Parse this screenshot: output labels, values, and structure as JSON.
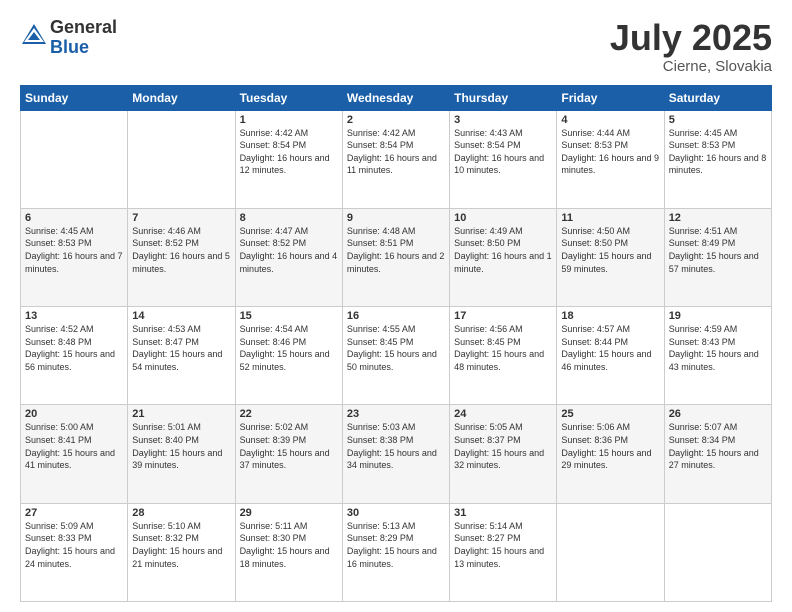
{
  "header": {
    "logo_general": "General",
    "logo_blue": "Blue",
    "month": "July 2025",
    "location": "Cierne, Slovakia"
  },
  "days_of_week": [
    "Sunday",
    "Monday",
    "Tuesday",
    "Wednesday",
    "Thursday",
    "Friday",
    "Saturday"
  ],
  "weeks": [
    [
      {
        "day": "",
        "info": ""
      },
      {
        "day": "",
        "info": ""
      },
      {
        "day": "1",
        "info": "Sunrise: 4:42 AM\nSunset: 8:54 PM\nDaylight: 16 hours and 12 minutes."
      },
      {
        "day": "2",
        "info": "Sunrise: 4:42 AM\nSunset: 8:54 PM\nDaylight: 16 hours and 11 minutes."
      },
      {
        "day": "3",
        "info": "Sunrise: 4:43 AM\nSunset: 8:54 PM\nDaylight: 16 hours and 10 minutes."
      },
      {
        "day": "4",
        "info": "Sunrise: 4:44 AM\nSunset: 8:53 PM\nDaylight: 16 hours and 9 minutes."
      },
      {
        "day": "5",
        "info": "Sunrise: 4:45 AM\nSunset: 8:53 PM\nDaylight: 16 hours and 8 minutes."
      }
    ],
    [
      {
        "day": "6",
        "info": "Sunrise: 4:45 AM\nSunset: 8:53 PM\nDaylight: 16 hours and 7 minutes."
      },
      {
        "day": "7",
        "info": "Sunrise: 4:46 AM\nSunset: 8:52 PM\nDaylight: 16 hours and 5 minutes."
      },
      {
        "day": "8",
        "info": "Sunrise: 4:47 AM\nSunset: 8:52 PM\nDaylight: 16 hours and 4 minutes."
      },
      {
        "day": "9",
        "info": "Sunrise: 4:48 AM\nSunset: 8:51 PM\nDaylight: 16 hours and 2 minutes."
      },
      {
        "day": "10",
        "info": "Sunrise: 4:49 AM\nSunset: 8:50 PM\nDaylight: 16 hours and 1 minute."
      },
      {
        "day": "11",
        "info": "Sunrise: 4:50 AM\nSunset: 8:50 PM\nDaylight: 15 hours and 59 minutes."
      },
      {
        "day": "12",
        "info": "Sunrise: 4:51 AM\nSunset: 8:49 PM\nDaylight: 15 hours and 57 minutes."
      }
    ],
    [
      {
        "day": "13",
        "info": "Sunrise: 4:52 AM\nSunset: 8:48 PM\nDaylight: 15 hours and 56 minutes."
      },
      {
        "day": "14",
        "info": "Sunrise: 4:53 AM\nSunset: 8:47 PM\nDaylight: 15 hours and 54 minutes."
      },
      {
        "day": "15",
        "info": "Sunrise: 4:54 AM\nSunset: 8:46 PM\nDaylight: 15 hours and 52 minutes."
      },
      {
        "day": "16",
        "info": "Sunrise: 4:55 AM\nSunset: 8:45 PM\nDaylight: 15 hours and 50 minutes."
      },
      {
        "day": "17",
        "info": "Sunrise: 4:56 AM\nSunset: 8:45 PM\nDaylight: 15 hours and 48 minutes."
      },
      {
        "day": "18",
        "info": "Sunrise: 4:57 AM\nSunset: 8:44 PM\nDaylight: 15 hours and 46 minutes."
      },
      {
        "day": "19",
        "info": "Sunrise: 4:59 AM\nSunset: 8:43 PM\nDaylight: 15 hours and 43 minutes."
      }
    ],
    [
      {
        "day": "20",
        "info": "Sunrise: 5:00 AM\nSunset: 8:41 PM\nDaylight: 15 hours and 41 minutes."
      },
      {
        "day": "21",
        "info": "Sunrise: 5:01 AM\nSunset: 8:40 PM\nDaylight: 15 hours and 39 minutes."
      },
      {
        "day": "22",
        "info": "Sunrise: 5:02 AM\nSunset: 8:39 PM\nDaylight: 15 hours and 37 minutes."
      },
      {
        "day": "23",
        "info": "Sunrise: 5:03 AM\nSunset: 8:38 PM\nDaylight: 15 hours and 34 minutes."
      },
      {
        "day": "24",
        "info": "Sunrise: 5:05 AM\nSunset: 8:37 PM\nDaylight: 15 hours and 32 minutes."
      },
      {
        "day": "25",
        "info": "Sunrise: 5:06 AM\nSunset: 8:36 PM\nDaylight: 15 hours and 29 minutes."
      },
      {
        "day": "26",
        "info": "Sunrise: 5:07 AM\nSunset: 8:34 PM\nDaylight: 15 hours and 27 minutes."
      }
    ],
    [
      {
        "day": "27",
        "info": "Sunrise: 5:09 AM\nSunset: 8:33 PM\nDaylight: 15 hours and 24 minutes."
      },
      {
        "day": "28",
        "info": "Sunrise: 5:10 AM\nSunset: 8:32 PM\nDaylight: 15 hours and 21 minutes."
      },
      {
        "day": "29",
        "info": "Sunrise: 5:11 AM\nSunset: 8:30 PM\nDaylight: 15 hours and 18 minutes."
      },
      {
        "day": "30",
        "info": "Sunrise: 5:13 AM\nSunset: 8:29 PM\nDaylight: 15 hours and 16 minutes."
      },
      {
        "day": "31",
        "info": "Sunrise: 5:14 AM\nSunset: 8:27 PM\nDaylight: 15 hours and 13 minutes."
      },
      {
        "day": "",
        "info": ""
      },
      {
        "day": "",
        "info": ""
      }
    ]
  ]
}
